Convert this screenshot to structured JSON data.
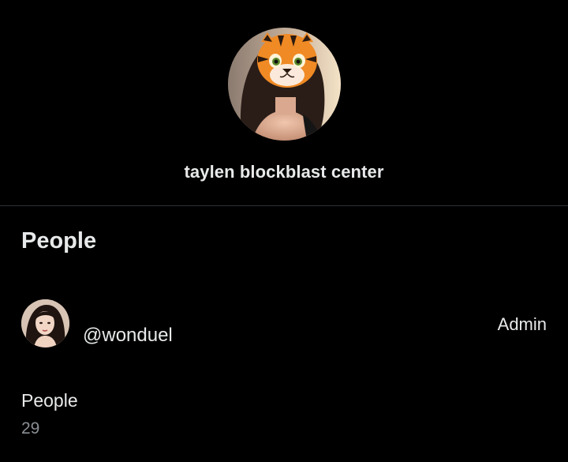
{
  "group": {
    "name": "taylen blockblast center",
    "avatar_icon": "tiger-face-avatar"
  },
  "people_section": {
    "title": "People",
    "members": [
      {
        "handle": "@wonduel",
        "role": "Admin",
        "avatar_icon": "user-photo-avatar"
      }
    ]
  },
  "stats": {
    "people_label": "People",
    "people_count": "29"
  },
  "colors": {
    "background": "#000000",
    "text_primary": "#e7e9ea",
    "text_secondary": "#8b8f93",
    "divider": "#2f3336"
  }
}
